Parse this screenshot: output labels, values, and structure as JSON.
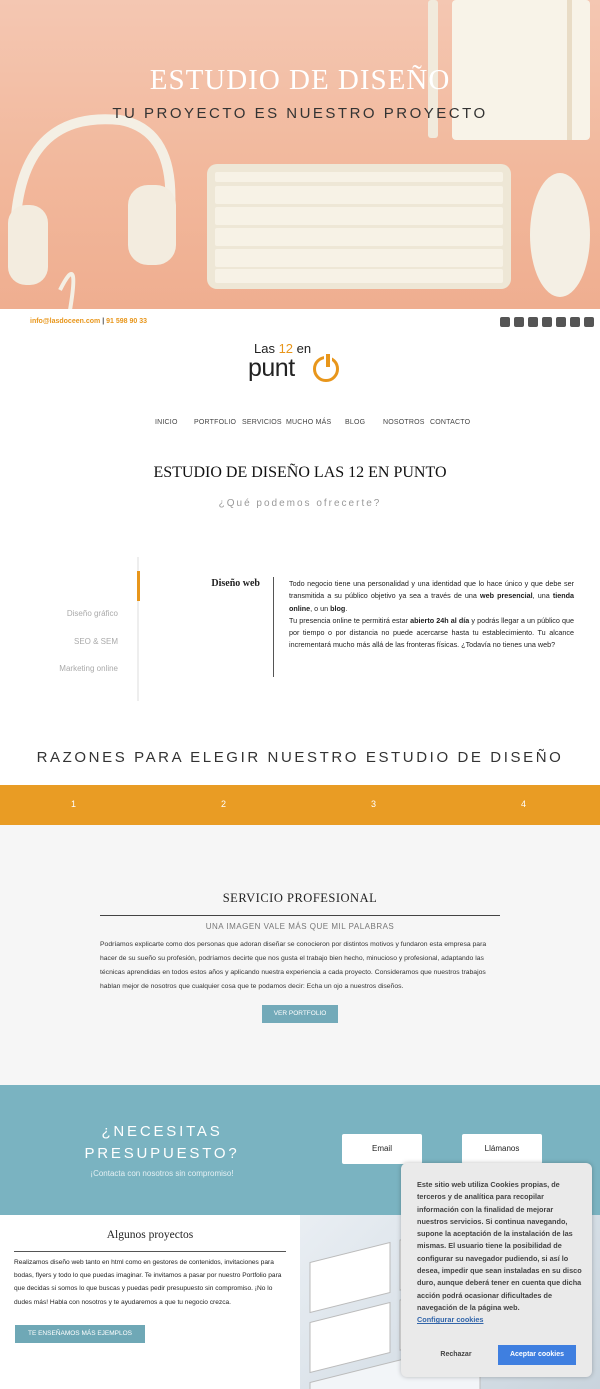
{
  "hero": {
    "title": "ESTUDIO DE DISEÑO",
    "subtitle": "TU PROYECTO ES NUESTRO PROYECTO"
  },
  "topbar": {
    "email": "info@lasdoceen.com",
    "separator": "|",
    "phone": "91 598 90 33",
    "social_icons": [
      "google-plus-icon",
      "linkedin-icon",
      "twitter-icon",
      "facebook-icon",
      "instagram-icon",
      "youtube-icon",
      "pinterest-icon"
    ]
  },
  "logo": {
    "line1_pre": "Las ",
    "line1_num": "12",
    "line1_post": " en",
    "line2": "punt",
    "accent": "#e8961b"
  },
  "nav": {
    "items": [
      "INICIO",
      "PORTFOLIO",
      "SERVICIOS",
      "MUCHO MÁS",
      "BLOG",
      "NOSOTROS",
      "CONTACTO"
    ]
  },
  "intro": {
    "title": "ESTUDIO DE DISEÑO LAS 12 EN PUNTO",
    "subtitle": "¿Qué podemos ofrecerte?"
  },
  "tabs": {
    "active": "Diseño web",
    "others": [
      "Diseño gráfico",
      "SEO & SEM",
      "Marketing online"
    ],
    "content_p1_a": "Todo negocio tiene una personalidad y una identidad que lo hace único y que debe ser transmitida a su público objetivo ya sea a través de una ",
    "content_p1_b1": "web presencial",
    "content_p1_c": ", una ",
    "content_p1_b2": "tienda online",
    "content_p1_d": ", o un ",
    "content_p1_b3": "blog",
    "content_p1_e": ".",
    "content_p2_a": "Tu presencia online te permitirá estar ",
    "content_p2_b": "abierto 24h al día",
    "content_p2_c": " y podrás llegar a un público que por tiempo o por distancia no puede acercarse hasta tu establecimiento. Tu alcance incrementará mucho más allá de las fronteras físicas. ¿Todavía no tienes una web?"
  },
  "reasons": {
    "title": "RAZONES PARA ELEGIR NUESTRO ESTUDIO DE DISEÑO",
    "numbers": [
      "1",
      "2",
      "3",
      "4"
    ],
    "accent": "#e99c24"
  },
  "service": {
    "title": "SERVICIO PROFESIONAL",
    "subtitle": "UNA IMAGEN VALE MÁS QUE MIL PALABRAS",
    "text": "Podríamos explicarte como dos personas que adoran diseñar se conocieron por distintos motivos y fundaron esta empresa para hacer de su sueño su profesión, podríamos decirte que nos gusta el trabajo bien hecho, minucioso y profesional, adaptando las técnicas aprendidas en todos estos años y aplicando nuestra experiencia a cada proyecto. Consideramos que nuestros trabajos hablan mejor de nosotros que cualquier cosa que te podamos decir: Echa un ojo a nuestros diseños.",
    "button": "VER PORTFOLIO"
  },
  "budget": {
    "title": "¿NECESITAS PRESUPUESTO?",
    "subtitle": "¡Contacta con nosotros sin compromiso!",
    "email_button": "Email",
    "call_button": "Llámanos",
    "color": "#7ab3c1"
  },
  "projects": {
    "title": "Algunos proyectos",
    "text": "Realizamos diseño web tanto en html como en gestores de contenidos, invitaciones para bodas, flyers y todo lo que puedas imaginar. Te invitamos a pasar por nuestro Portfolio para que decidas si somos lo que buscas y puedas pedir presupuesto sin compromiso. ¡No lo dudes más! Habla con nosotros y te ayudaremos a que tu negocio crezca.",
    "button": "TE ENSEÑAMOS MÁS EJEMPLOS"
  },
  "cookie": {
    "text": "Este sitio web utiliza Cookies propias, de terceros y de analítica para recopilar información con la finalidad de mejorar nuestros servicios. Si continua navegando, supone la aceptación de la instalación de las mismas. El usuario tiene la posibilidad de configurar su navegador pudiendo, si así lo desea, impedir que sean instaladas en su disco duro, aunque deberá tener en cuenta que dicha acción podrá ocasionar dificultades de navegación de la página web.",
    "config_link": "Configurar cookies",
    "reject": "Rechazar",
    "accept": "Aceptar cookies"
  }
}
